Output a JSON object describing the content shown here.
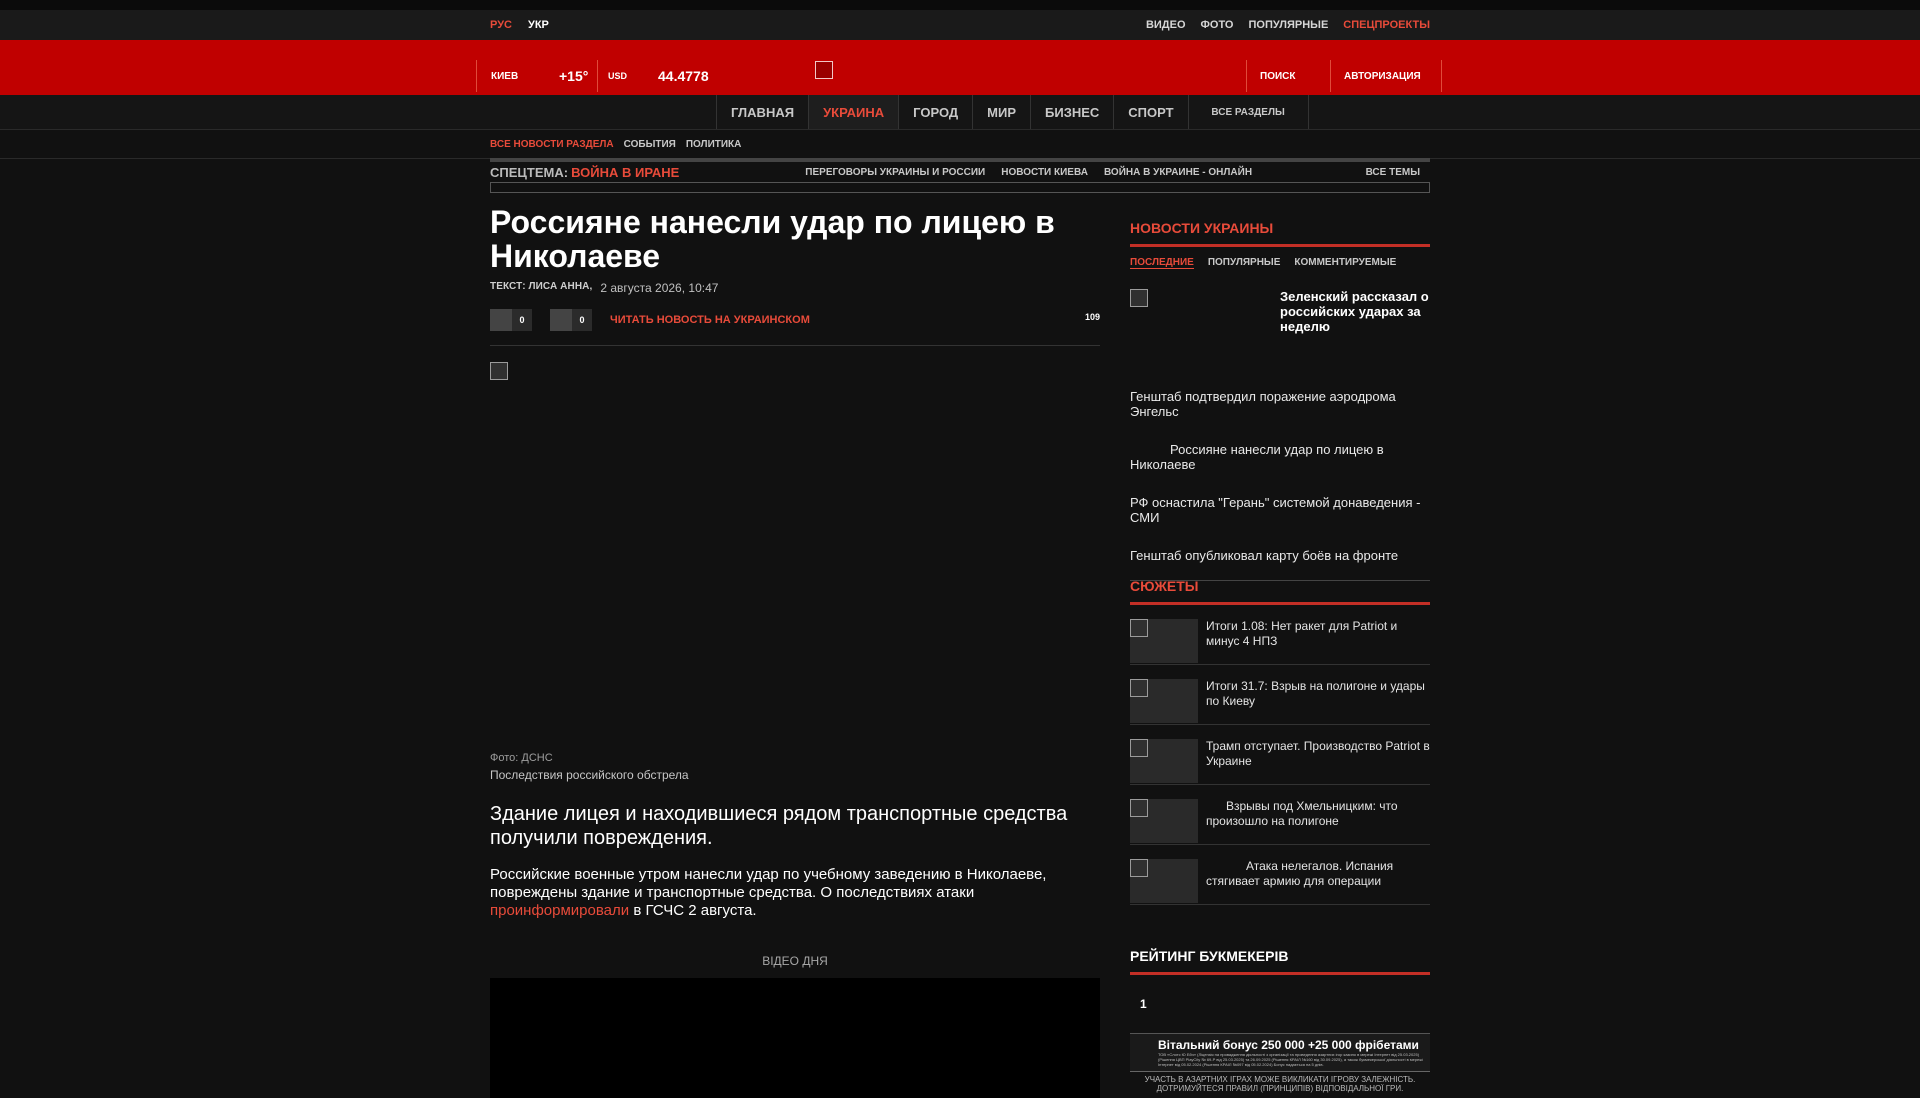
{
  "topstrip": {
    "lang": [
      "РУС",
      "УКР"
    ],
    "links": [
      {
        "label": "ВИДЕО",
        "accent": false
      },
      {
        "label": "ФОТО",
        "accent": false
      },
      {
        "label": "ПОПУЛЯРНЫЕ",
        "accent": false
      },
      {
        "label": "СПЕЦПРОЕКТЫ",
        "accent": true
      }
    ]
  },
  "header": {
    "city": "КИЕВ",
    "temperature": "+15°",
    "currency": "USD",
    "rate": "44.4778",
    "search": "ПОИСК",
    "auth": "АВТОРИЗАЦИЯ"
  },
  "nav": {
    "items": [
      "ГЛАВНАЯ",
      "УКРАИНА",
      "ГОРОД",
      "МИР",
      "БИЗНЕС",
      "СПОРТ"
    ],
    "active_index": 1,
    "all_sections": "ВСЕ РАЗДЕЛЫ"
  },
  "subnav": {
    "items": [
      "ВСЕ НОВОСТИ РАЗДЕЛА",
      "СОБЫТИЯ",
      "ПОЛИТИКА"
    ]
  },
  "spec": {
    "label": "СПЕЦТЕМА:",
    "hot": "ВОЙНА В ИРАНЕ",
    "links": [
      "ПЕРЕГОВОРЫ УКРАИНЫ И РОССИИ",
      "НОВОСТИ КИЕВА",
      "ВОЙНА В УКРАИНЕ - ОНЛАЙН"
    ],
    "all": "ВСЕ ТЕМЫ"
  },
  "article": {
    "title": "Россияне нанесли удар по лицею в Николаеве",
    "author": "ТЕКСТ: ЛИСА АННА,",
    "date": "2 августа 2026, 10:47",
    "share1_count": "0",
    "share2_count": "0",
    "read_ua": "ЧИТАТЬ НОВОСТЬ НА УКРАИНСКОМ",
    "views": "109",
    "photo_credit": "Фото: ДСНС",
    "photo_caption": "Последствия российского обстрела",
    "lead": "Здание лицея и находившиеся рядом транспортные средства получили повреждения.",
    "body_pre": "Российские военные утром нанесли удар по учебному заведению в Николаеве, повреждены здание и транспортные средства. О последствиях атаки ",
    "body_link": "проинформировали",
    "body_post": " в ГСЧС 2 августа.",
    "video_label": "ВІДЕО ДНЯ"
  },
  "sidebar": {
    "news_title": "НОВОСТИ УКРАИНЫ",
    "tabs": [
      "ПОСЛЕДНИЕ",
      "ПОПУЛЯРНЫЕ",
      "КОММЕНТИРУЕМЫЕ"
    ],
    "featured": "Зеленский рассказал о российских ударах за неделю",
    "news": [
      "Генштаб подтвердил поражение аэродрома Энгельс",
      "Россияне нанесли удар по лицею в Николаеве",
      "РФ оснастила \"Герань\" системой донаведения - СМИ",
      "Генштаб опубликовал карту боёв на фронте"
    ],
    "stories_title": "СЮЖЕТЫ",
    "stories": [
      "Итоги 1.08: Нет ракет для Patriot и минус 4 НПЗ",
      "Итоги 31.7: Взрыв на полигоне и удары по Киеву",
      "Трамп отступает. Производство Patriot в Украине",
      "Взрывы под Хмельницким: что произошло на полигоне",
      "Атака нелегалов. Испания стягивает армию для операции"
    ],
    "rating_title": "РЕЙТИНГ БУКМЕКЕРІВ",
    "rating_num": "1",
    "bonus": "Вітальний бонус 250 000 +25 000 фрібетами",
    "bonus_small": "ТОВ «Слотс Ю Ейч» (Ліцензія на провадження діяльності з організації та проведення азартних ігор казино в мережі Інтернет від 25.03.2025) (Рішення ЦВП PlayCity № 69-Р від 25.03.2025) та 26.09.2025 (Рішення КРАІЛ №160 від 30.09.2025), а також букмекерської діяльності в мережі Інтернет від 05.02.2024 (Рішення КРАІЛ №097 від 05.02.2024) Бонус надається на 5 днів.",
    "warning": "УЧАСТЬ В АЗАРТНИХ ІГРАХ МОЖЕ ВИКЛИКАТИ ІГРОВУ ЗАЛЕЖНІСТЬ. ДОТРИМУЙТЕСЯ ПРАВИЛ (ПРИНЦИПІВ) ВІДПОВІДАЛЬНОЇ ГРИ."
  }
}
